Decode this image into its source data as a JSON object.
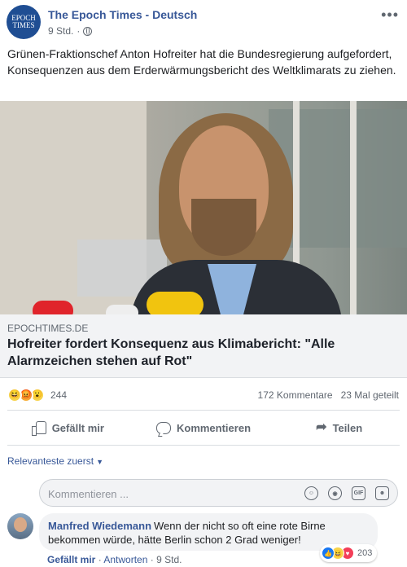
{
  "header": {
    "page_name": "The Epoch Times - Deutsch",
    "logo_text_line1": "EPOCH",
    "logo_text_line2": "TIMES",
    "time": "9 Std.",
    "separator": "·",
    "more": "•••"
  },
  "post": {
    "text": "Grünen-Fraktionschef Anton Hofreiter hat die Bundesregierung aufgefordert, Konsequenzen aus dem Erderwärmungsbericht des Weltklimarats zu ziehen."
  },
  "link": {
    "domain": "EPOCHTIMES.DE",
    "title": "Hofreiter fordert Konsequenz aus Klimabericht: \"Alle Alarmzeichen stehen auf Rot\""
  },
  "stats": {
    "reactions_count": "244",
    "reaction_types": [
      "haha",
      "angry",
      "wow"
    ],
    "comments": "172 Kommentare",
    "shares": "23 Mal geteilt"
  },
  "actions": {
    "like": "Gefällt mir",
    "comment": "Kommentieren",
    "share": "Teilen"
  },
  "comments_section": {
    "sort_label": "Relevanteste zuerst",
    "input_placeholder": "Kommentieren ...",
    "input_icons": [
      "emoji-icon",
      "camera-icon",
      "gif-icon",
      "sticker-icon"
    ]
  },
  "comment": {
    "author": "Manfred Wiedemann",
    "text": "Wenn der nicht so oft eine rote Birne bekommen würde, hätte Berlin schon 2 Grad weniger!",
    "reactions_count": "203",
    "like": "Gefällt mir",
    "reply": "Antworten",
    "time": "9 Std."
  },
  "colors": {
    "brand_blue": "#385898",
    "logo_blue": "#1f4e93",
    "muted_text": "#606770"
  }
}
